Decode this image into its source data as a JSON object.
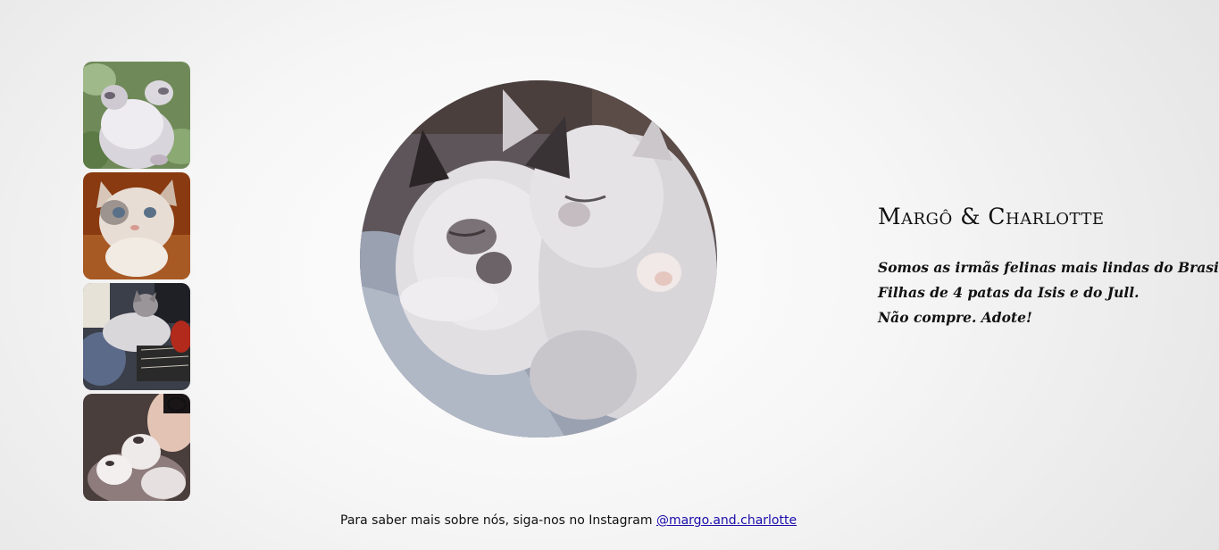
{
  "gallery": {
    "thumbnails": [
      {
        "icon": "photo-kittens-sleeping-on-back"
      },
      {
        "icon": "photo-cat-face-closeup"
      },
      {
        "icon": "photo-cat-on-guitar"
      },
      {
        "icon": "photo-kittens-with-person"
      }
    ]
  },
  "hero": {
    "icon": "photo-kittens-cuddling"
  },
  "profile": {
    "title": "Margô & Charlotte",
    "bio": [
      "Somos as irmãs felinas mais lindas do Brasil.",
      "Filhas de 4 patas da Isis e do Jull.",
      "Não compre. Adote!"
    ]
  },
  "footer": {
    "text": "Para saber mais sobre nós, siga-nos no Instagram",
    "link_label": "@margo.and.charlotte"
  },
  "colors": {
    "link": "#1a0dab",
    "text": "#111111"
  }
}
